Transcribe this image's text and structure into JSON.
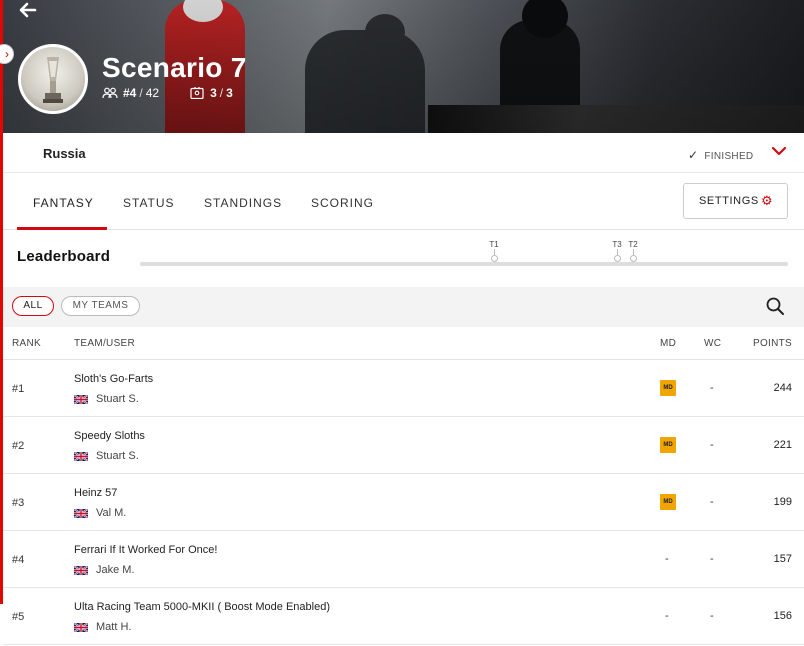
{
  "hero": {
    "title": "Scenario 7",
    "rank": "#4",
    "total": "42",
    "teams_used": "3",
    "teams_max": "3"
  },
  "location": {
    "name": "Russia",
    "status": "FINISHED"
  },
  "tabs": [
    {
      "label": "FANTASY",
      "active": true
    },
    {
      "label": "STATUS",
      "active": false
    },
    {
      "label": "STANDINGS",
      "active": false
    },
    {
      "label": "SCORING",
      "active": false
    }
  ],
  "settings_label": "SETTINGS",
  "leaderboard": {
    "title": "Leaderboard",
    "timeline_marks": [
      "T1",
      "T3",
      "T2"
    ]
  },
  "filters": {
    "all": "ALL",
    "my_teams": "MY TEAMS"
  },
  "table": {
    "headers": {
      "rank": "RANK",
      "team": "TEAM/USER",
      "md": "MD",
      "wc": "WC",
      "points": "POINTS"
    },
    "rows": [
      {
        "rank": "#1",
        "team": "Sloth's Go-Farts",
        "user": "Stuart S.",
        "md": "MD",
        "wc": "-",
        "points": "244"
      },
      {
        "rank": "#2",
        "team": "Speedy Sloths",
        "user": "Stuart S.",
        "md": "MD",
        "wc": "-",
        "points": "221"
      },
      {
        "rank": "#3",
        "team": "Heinz 57",
        "user": "Val M.",
        "md": "MD",
        "wc": "-",
        "points": "199"
      },
      {
        "rank": "#4",
        "team": "Ferrari If It Worked For Once!",
        "user": "Jake M.",
        "md": "-",
        "wc": "-",
        "points": "157"
      },
      {
        "rank": "#5",
        "team": "Ulta Racing Team 5000-MKII ( Boost Mode Enabled)",
        "user": "Matt H.",
        "md": "-",
        "wc": "-",
        "points": "156"
      }
    ]
  },
  "colors": {
    "accent": "#d10a11",
    "md_badge": "#f0a500"
  }
}
